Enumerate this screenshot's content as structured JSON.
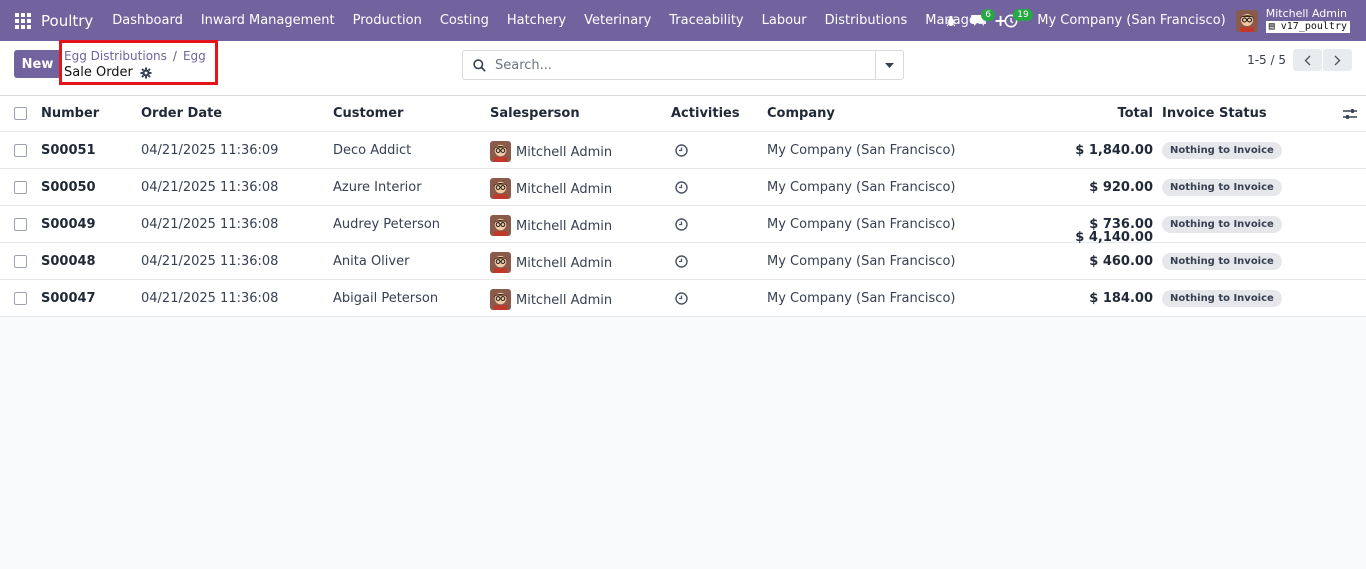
{
  "navbar": {
    "app_name": "Poultry",
    "menu": [
      "Dashboard",
      "Inward Management",
      "Production",
      "Costing",
      "Hatchery",
      "Veterinary",
      "Traceability",
      "Labour",
      "Distributions",
      "Manage"
    ],
    "plus": "+",
    "messages_count": "6",
    "activities_count": "19",
    "company": "My Company (San Francisco)",
    "user_name": "Mitchell Admin",
    "database": "v17_poultry",
    "color": "#71639e"
  },
  "control": {
    "new_label": "New",
    "breadcrumbs": [
      "Egg Distributions",
      "Egg"
    ],
    "separator": "/",
    "title": "Sale Order",
    "search_placeholder": "Search...",
    "pager": "1-5 / 5"
  },
  "list": {
    "columns": {
      "number": "Number",
      "order_date": "Order Date",
      "customer": "Customer",
      "salesperson": "Salesperson",
      "activities": "Activities",
      "company": "Company",
      "total": "Total",
      "invoice_status": "Invoice Status"
    },
    "rows": [
      {
        "number": "S00051",
        "date": "04/21/2025 11:36:09",
        "customer": "Deco Addict",
        "salesperson": "Mitchell Admin",
        "company": "My Company (San Francisco)",
        "total": "$ 1,840.00",
        "status": "Nothing to Invoice"
      },
      {
        "number": "S00050",
        "date": "04/21/2025 11:36:08",
        "customer": "Azure Interior",
        "salesperson": "Mitchell Admin",
        "company": "My Company (San Francisco)",
        "total": "$ 920.00",
        "status": "Nothing to Invoice"
      },
      {
        "number": "S00049",
        "date": "04/21/2025 11:36:08",
        "customer": "Audrey Peterson",
        "salesperson": "Mitchell Admin",
        "company": "My Company (San Francisco)",
        "total": "$ 736.00",
        "status": "Nothing to Invoice"
      },
      {
        "number": "S00048",
        "date": "04/21/2025 11:36:08",
        "customer": "Anita Oliver",
        "salesperson": "Mitchell Admin",
        "company": "My Company (San Francisco)",
        "total": "$ 460.00",
        "status": "Nothing to Invoice"
      },
      {
        "number": "S00047",
        "date": "04/21/2025 11:36:08",
        "customer": "Abigail Peterson",
        "salesperson": "Mitchell Admin",
        "company": "My Company (San Francisco)",
        "total": "$ 184.00",
        "status": "Nothing to Invoice"
      }
    ],
    "grand_total": "$ 4,140.00"
  }
}
